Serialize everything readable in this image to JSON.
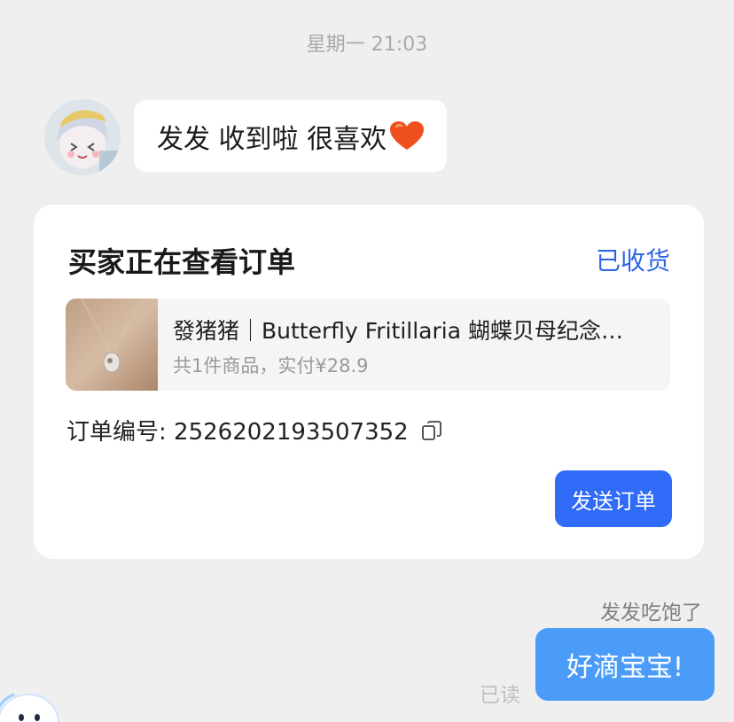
{
  "chat": {
    "timestamp": "星期一 21:03",
    "incoming_message": "发发  收到啦  很喜欢"
  },
  "order_card": {
    "title": "买家正在查看订单",
    "status": "已收货",
    "product_name": "發猪猪｜Butterfly Fritillaria 蝴蝶贝母纪念…",
    "product_summary": "共1件商品，实付¥28.9",
    "order_number_label": "订单编号: 2526202193507352",
    "send_button_label": "发送订单"
  },
  "outgoing": {
    "sender_label": "发发吃饱了",
    "message": "好滴宝宝!",
    "read_status": "已读"
  },
  "colors": {
    "background": "#efefef",
    "accent_blue": "#2e66e6",
    "button_blue": "#2f6bf6",
    "outgoing_bubble": "#4b9cf8"
  },
  "icons": {
    "heart": "heart-emoji-icon",
    "copy": "copy-icon"
  }
}
